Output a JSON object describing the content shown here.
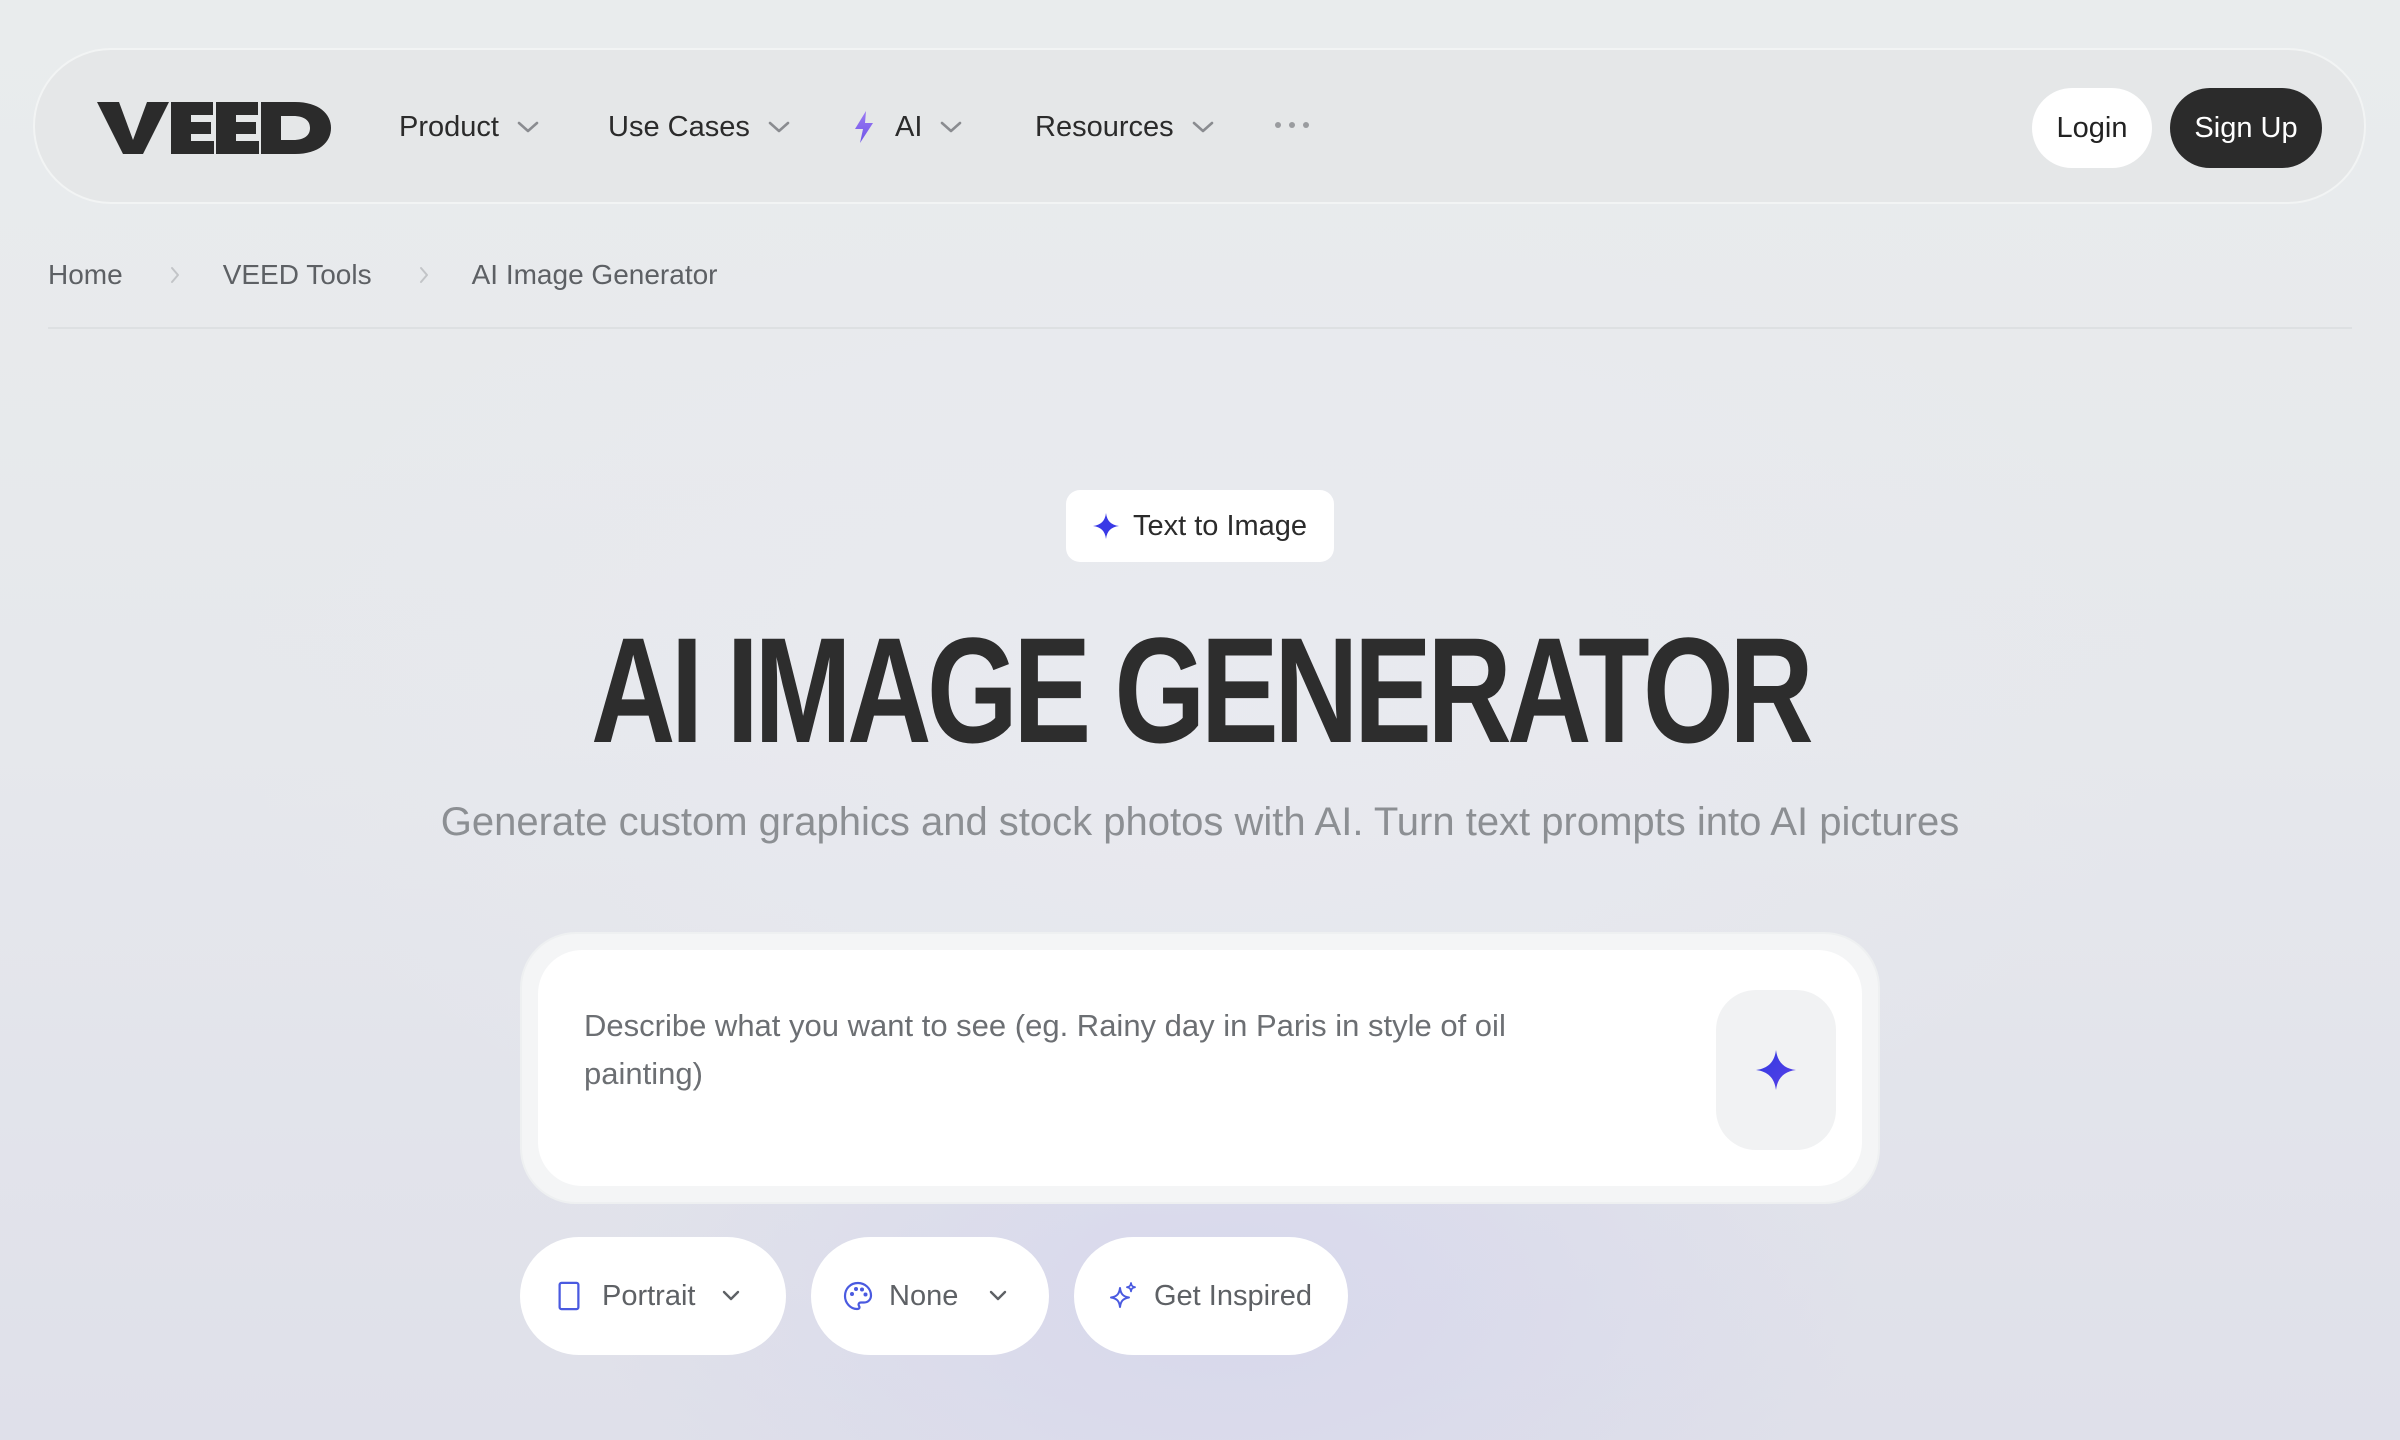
{
  "header": {
    "logo_text": "VEED",
    "nav": [
      {
        "label": "Product",
        "icon": "chevron-down-icon"
      },
      {
        "label": "Use Cases",
        "icon": "chevron-down-icon"
      },
      {
        "label": "AI",
        "icon": "chevron-down-icon",
        "leading_icon": "lightning-bolt-icon"
      },
      {
        "label": "Resources",
        "icon": "chevron-down-icon"
      }
    ],
    "more_icon": "ellipsis-icon",
    "login_label": "Login",
    "signup_label": "Sign Up"
  },
  "breadcrumb": {
    "items": [
      "Home",
      "VEED Tools",
      "AI Image Generator"
    ],
    "separator_icon": "chevron-right-icon"
  },
  "hero": {
    "badge_icon": "sparkle-icon",
    "badge_label": "Text to Image",
    "title": "AI IMAGE GENERATOR",
    "subtitle": "Generate custom graphics and stock photos with AI. Turn text prompts into AI pictures"
  },
  "prompt": {
    "value": "",
    "placeholder": "Describe what you want to see (eg. Rainy day in Paris in style of oil painting)",
    "submit_icon": "sparkle-icon"
  },
  "options": {
    "aspect": {
      "icon": "portrait-icon",
      "value": "Portrait"
    },
    "style": {
      "icon": "palette-icon",
      "value": "None"
    },
    "inspire": {
      "icon": "sparkles-icon",
      "label": "Get Inspired"
    }
  },
  "colors": {
    "background": "#e7e9ec",
    "text_dark": "#2b2b2b",
    "text_muted": "#8c8f93",
    "accent": "#3a3ae6",
    "ai_accent": "#8b6bf0",
    "signup_bg": "#2b2b2b"
  }
}
